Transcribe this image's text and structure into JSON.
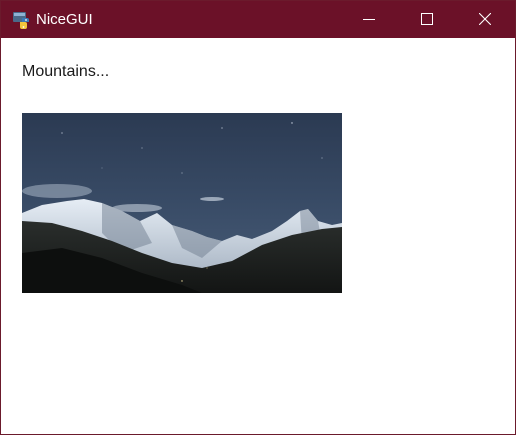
{
  "window": {
    "title": "NiceGUI",
    "controls": {
      "minimize": "minimize-icon",
      "maximize": "maximize-icon",
      "close": "close-icon"
    },
    "title_bar_color": "#6b1128"
  },
  "content": {
    "label": "Mountains...",
    "image": {
      "subject": "snow-capped mountains under a night sky"
    }
  }
}
